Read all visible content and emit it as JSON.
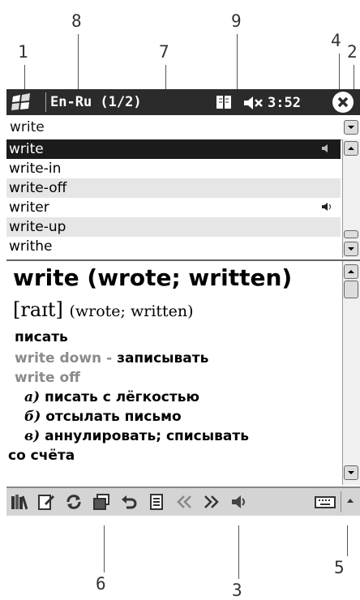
{
  "callouts": [
    "1",
    "2",
    "3",
    "4",
    "5",
    "6",
    "7",
    "8",
    "9"
  ],
  "titlebar": {
    "title": "En-Ru (1/2)",
    "clock": "3:52"
  },
  "search": {
    "value": "write"
  },
  "wordlist": {
    "items": [
      "write",
      "write-in",
      "write-off",
      "writer",
      "write-up",
      "writhe"
    ]
  },
  "article": {
    "headword": "write (wrote; written)",
    "transcription": "[raɪt]",
    "forms": "(wrote; written)",
    "sense1": "писать",
    "phrase1": "write down",
    "phrase1_dash": " - ",
    "phrase1_tr": "записывать",
    "phrase2": "write off",
    "sub_a_num": "а)",
    "sub_a": " писать с лёгкостью",
    "sub_b_num": "б)",
    "sub_b": " отсылать письмо",
    "sub_c_num": "в)",
    "sub_c": " аннулировать; списывать",
    "sub_c_cont": "со счёта"
  },
  "toolbar": {
    "icons": [
      "library-icon",
      "edit-icon",
      "refresh-icon",
      "cards-icon",
      "undo-icon",
      "list-icon",
      "back-icon",
      "forward-icon",
      "speaker-icon",
      "keyboard-icon",
      "sip-arrow-icon"
    ]
  },
  "colors": {
    "titlebar": "#2b2b2b",
    "selection": "#1b1b1b",
    "toolbar": "#d4d4d4"
  }
}
